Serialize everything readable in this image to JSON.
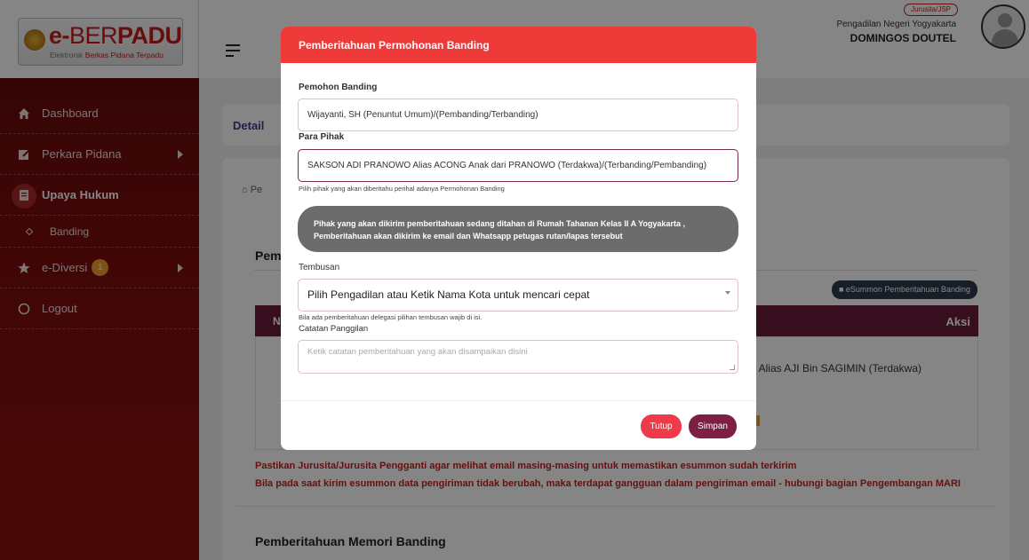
{
  "logo": {
    "brand_prefix": "e-",
    "brand_main_thin": "BER",
    "brand_main_bold": "PADU",
    "tagline_part1": "Elektronik ",
    "tagline_part2": "Berkas Pidana Terpadu"
  },
  "header": {
    "role": "Jurusita/JSP",
    "court": "Pengadilan Negeri Yogyakarta",
    "user": "DOMINGOS DOUTEL"
  },
  "sidebar": {
    "items": [
      {
        "label": "Dashboard"
      },
      {
        "label": "Perkara Pidana"
      },
      {
        "label": "Upaya Hukum"
      },
      {
        "label": "Banding"
      },
      {
        "label": "e-Diversi",
        "badge": "1"
      },
      {
        "label": "Logout"
      }
    ]
  },
  "page": {
    "detail_title": "Detail",
    "breadcrumb": "Pe",
    "section_title": "Pemb",
    "esummon_button": "eSummon Pemberitahuan Banding",
    "table_header_no": "N",
    "table_header_aksi": "Aksi",
    "table_cell_party": "TO AJI Alias AJI Bin SAGIMIN (Terdakwa)",
    "warning_1": "Pastikan Jurusita/Jurusita Pengganti agar melihat email masing-masing untuk memastikan esummon sudah terkirim",
    "warning_2": "Bila pada saat kirim esummon data pengiriman tidak berubah, maka terdapat gangguan dalam pengiriman email - hubungi bagian Pengembangan MARI",
    "memori_title": "Pemberitahuan Memori Banding"
  },
  "modal": {
    "title": "Pemberitahuan Permohonan Banding",
    "pemohon_label": "Pemohon Banding",
    "pemohon_value": "Wijayanti, SH (Penuntut Umum)/(Pembanding/Terbanding)",
    "pihak_label": "Para Pihak",
    "pihak_value": "SAKSON ADI PRANOWO Alias ACONG Anak dari PRANOWO (Terdakwa)/(Terbanding/Pembanding)",
    "pihak_help": "Pilih pihak yang akan diberitahu perihal adanya Permohonan Banding",
    "info_line1": "Pihak yang akan dikirim pemberitahuan sedang ditahan di Rumah Tahanan Kelas II A Yogyakarta ,",
    "info_line2": "Pemberitahuan akan dikirim ke email dan Whatsapp petugas rutan/lapas tersebut",
    "tembusan_label": "Tembusan",
    "tembusan_select": "Pilih Pengadilan atau Ketik Nama Kota untuk mencari cepat",
    "tembusan_help": "Bila ada pemberitahuan delegasi pilihan tembusan wajib di isi.",
    "catatan_label": "Catatan Panggilan",
    "catatan_placeholder": "Ketik catatan pemberitahuan yang akan disampaikan disini",
    "btn_tutup": "Tutup",
    "btn_simpan": "Simpan"
  }
}
